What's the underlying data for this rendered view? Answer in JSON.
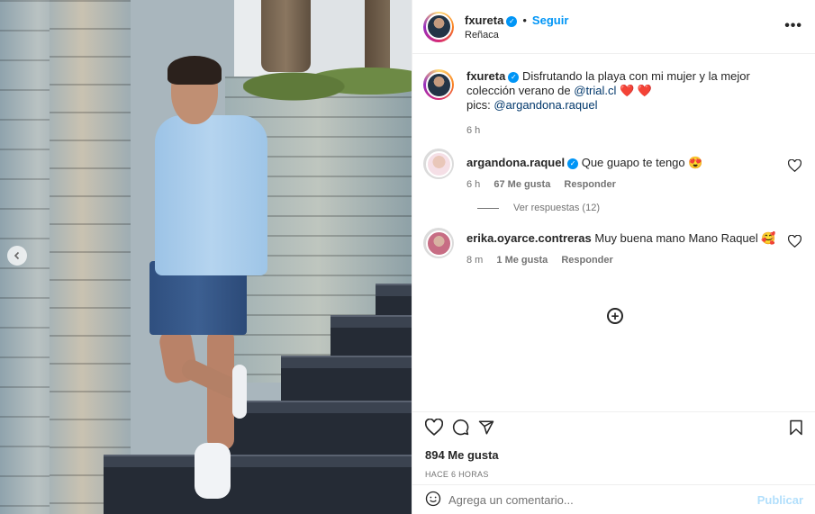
{
  "post": {
    "author": "fxureta",
    "follow_label": "Seguir",
    "separator": "•",
    "location": "Reñaca",
    "more_label": "•••",
    "caption": {
      "text": "Disfrutando la playa con mi mujer y la mejor colección verano de ",
      "mention1": "@trial.cl",
      "hearts": "❤️ ❤️",
      "pics_label": "pics: ",
      "mention2": "@argandona.raquel"
    },
    "caption_time": "6 h",
    "likes": "894 Me gusta",
    "posted_ago": "HACE 6 HORAS"
  },
  "comments": [
    {
      "user": "argandona.raquel",
      "verified": true,
      "text": "Que guapo te tengo 😍",
      "time": "6 h",
      "likes": "67 Me gusta",
      "reply": "Responder",
      "view_replies": "Ver respuestas (12)"
    },
    {
      "user": "erika.oyarce.contreras",
      "verified": false,
      "text": "Muy buena mano Mano Raquel 🥰",
      "time": "8 m",
      "likes": "1 Me gusta",
      "reply": "Responder"
    }
  ],
  "composer": {
    "placeholder": "Agrega un comentario...",
    "publish": "Publicar"
  },
  "icons": {
    "heart": "heart-icon",
    "comment": "comment-icon",
    "share": "share-icon",
    "save": "bookmark-icon",
    "emoji": "emoji-icon",
    "add": "plus-circle-icon",
    "prev": "chevron-left-icon"
  },
  "colors": {
    "accent": "#0095f6",
    "publish_disabled": "#b2dffc",
    "meta_gray": "#737373"
  }
}
